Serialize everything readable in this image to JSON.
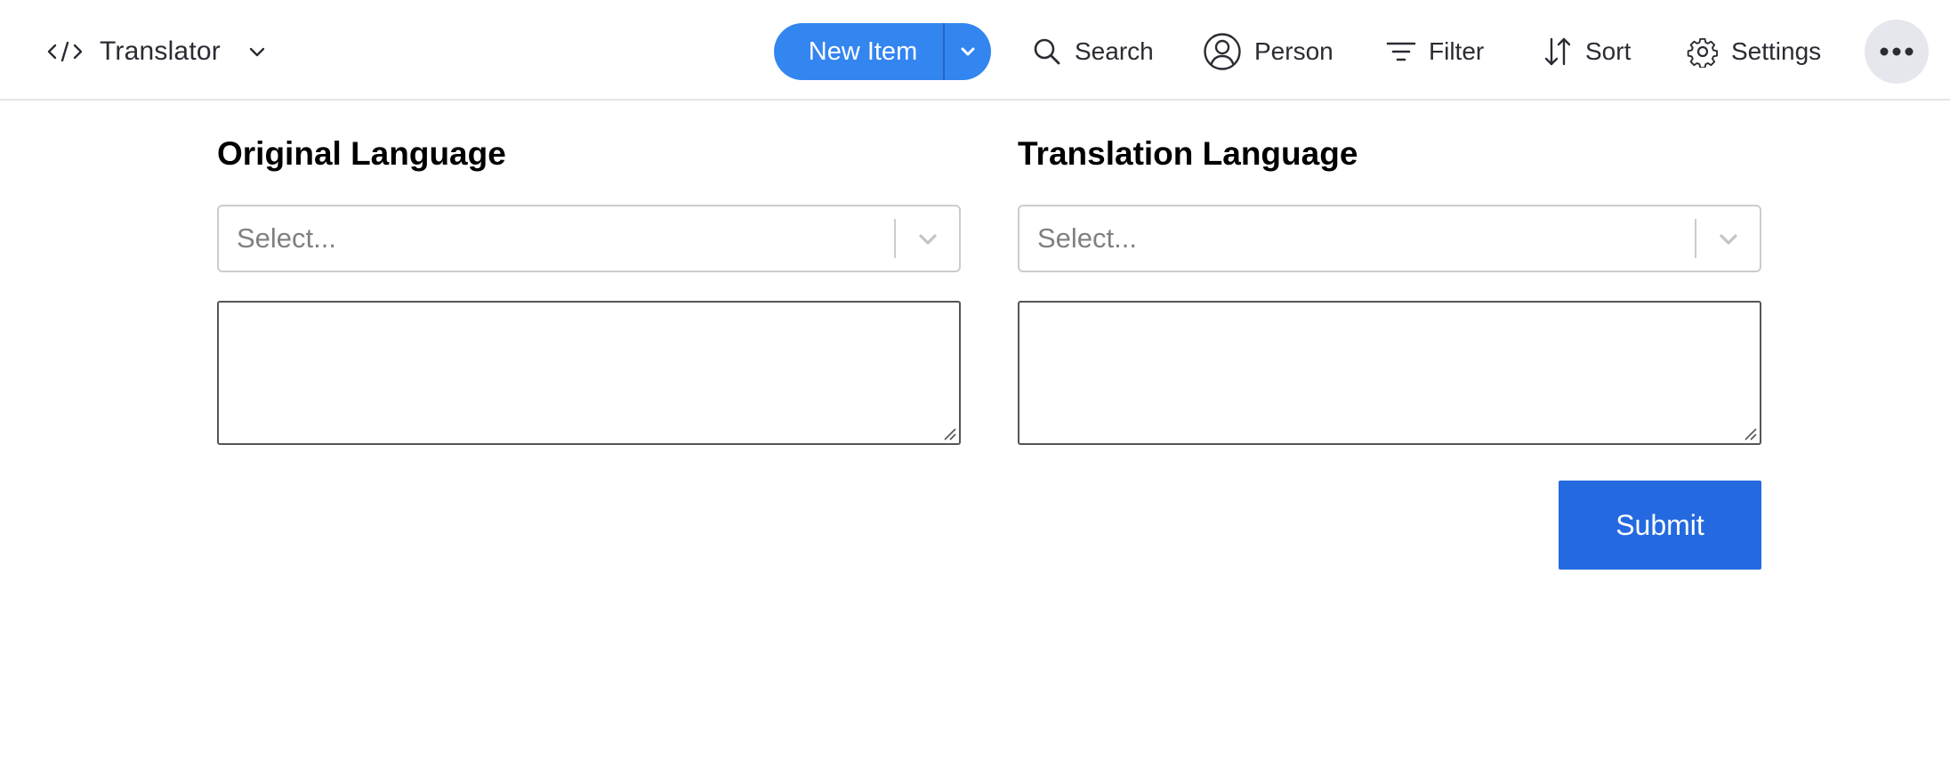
{
  "header": {
    "app_title": "Translator",
    "app_icon": "code-icon",
    "new_item_label": "New Item",
    "tools": {
      "search": "Search",
      "person": "Person",
      "filter": "Filter",
      "sort": "Sort",
      "settings": "Settings"
    }
  },
  "form": {
    "original": {
      "heading": "Original Language",
      "select_placeholder": "Select...",
      "text_value": ""
    },
    "translation": {
      "heading": "Translation Language",
      "select_placeholder": "Select...",
      "text_value": ""
    },
    "submit_label": "Submit"
  },
  "colors": {
    "primary": "#3385f0",
    "submit": "#2469e0",
    "more_button_bg": "#e6e7ec",
    "border": "#cccccc"
  }
}
